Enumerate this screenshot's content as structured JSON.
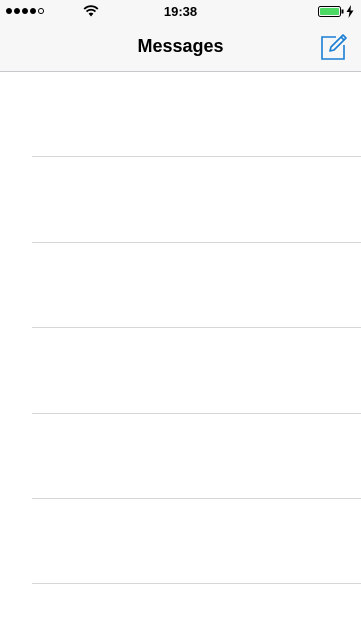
{
  "status_bar": {
    "signal_bars_filled": 4,
    "signal_bars_total": 5,
    "time": "19:38",
    "battery_color": "#4cd964",
    "icons": [
      "signal-dots-icon",
      "wifi-icon",
      "battery-icon",
      "charging-bolt-icon"
    ]
  },
  "nav": {
    "title": "Messages",
    "compose_icon": "compose-icon",
    "accent_color": "#1a7fd4"
  },
  "conversations": []
}
